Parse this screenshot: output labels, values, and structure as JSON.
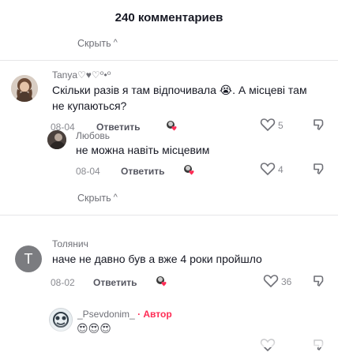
{
  "header": {
    "title": "240 комментариев"
  },
  "hide_label": "Скрыть",
  "comments": [
    {
      "username": "Tanya♡♥♡⁰•⁰",
      "text": "Скільки разів я там відпочивала 😭. А місцеві там не купаються?",
      "date": "08-04",
      "reply_label": "Ответить",
      "likes": "5"
    },
    {
      "username": "Любовь",
      "text": "не можна навіть місцевим",
      "date": "08-04",
      "reply_label": "Ответить",
      "likes": "4"
    },
    {
      "username": "Толянич",
      "avatar_letter": "T",
      "text": "наче не давно був а вже 4 роки пройшло",
      "date": "08-02",
      "reply_label": "Ответить",
      "likes": "36"
    },
    {
      "username": "_Psevdonim_",
      "author_badge": "· Автор",
      "text": "😍😍😍"
    }
  ],
  "colors": {
    "muted_text": "#6f7077",
    "avatar_grey": "#7b7c80",
    "author_pink": "#fe2c55"
  }
}
